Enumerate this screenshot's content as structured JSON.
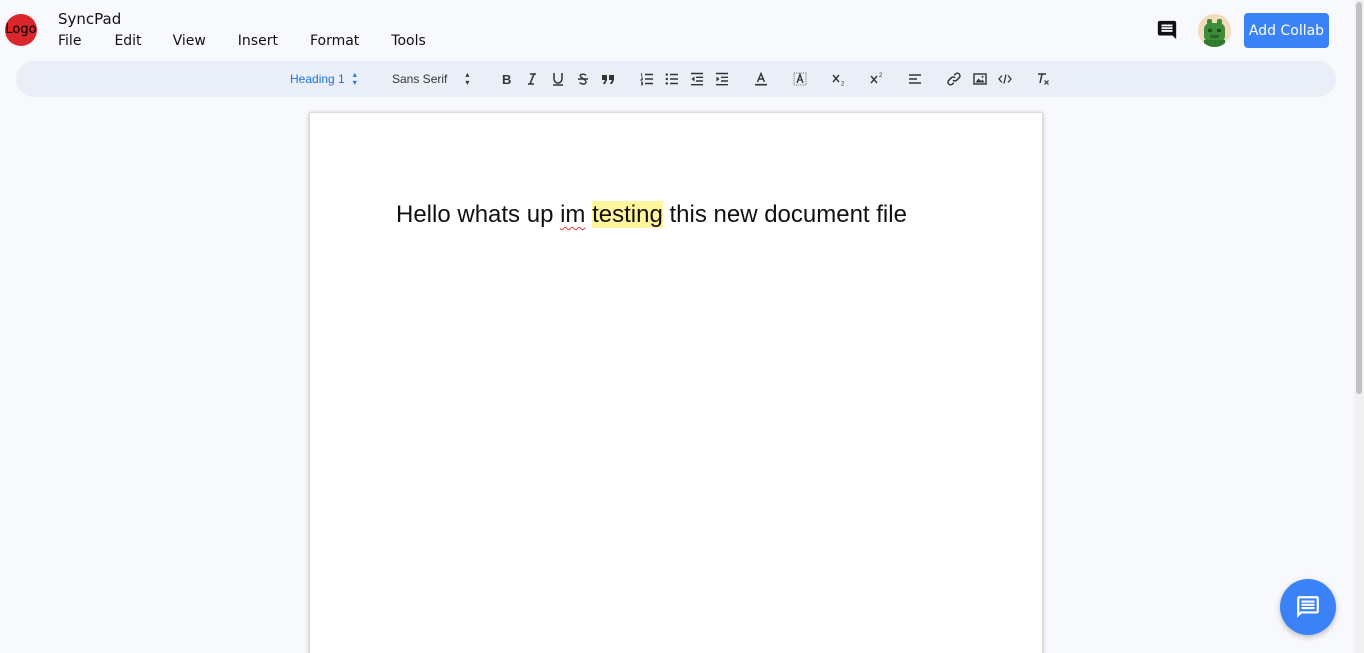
{
  "header": {
    "logo_text": "Logo",
    "app_title": "SyncPad",
    "menu": [
      {
        "label": "File"
      },
      {
        "label": "Edit"
      },
      {
        "label": "View"
      },
      {
        "label": "Insert"
      },
      {
        "label": "Format"
      },
      {
        "label": "Tools"
      }
    ],
    "add_collab_label": "Add Collab"
  },
  "toolbar": {
    "heading_select": "Heading 1",
    "font_select": "Sans Serif",
    "buttons": [
      "bold",
      "italic",
      "underline",
      "strike",
      "blockquote",
      "ordered-list",
      "bullet-list",
      "outdent",
      "indent",
      "text-color",
      "background-color",
      "subscript",
      "superscript",
      "align",
      "link",
      "image",
      "code",
      "clean"
    ],
    "accent_color": "#1a73e8"
  },
  "document": {
    "part1": "Hello whats up ",
    "misspelled": "im",
    "part2": " ",
    "highlighted": "testing",
    "part3": " this new document file"
  },
  "colors": {
    "primary_button": "#3b82f6",
    "logo": "#d8262a",
    "highlight": "#fff59d"
  }
}
